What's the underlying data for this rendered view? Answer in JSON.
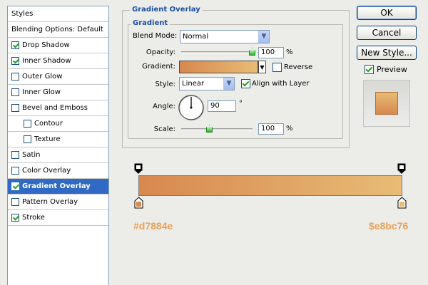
{
  "sidebar": {
    "header": "Styles",
    "items": [
      {
        "label": "Blending Options: Default",
        "checkbox": false,
        "checked": false,
        "indent": false,
        "selected": false
      },
      {
        "label": "Drop Shadow",
        "checkbox": true,
        "checked": true,
        "indent": false,
        "selected": false
      },
      {
        "label": "Inner Shadow",
        "checkbox": true,
        "checked": true,
        "indent": false,
        "selected": false
      },
      {
        "label": "Outer Glow",
        "checkbox": true,
        "checked": false,
        "indent": false,
        "selected": false
      },
      {
        "label": "Inner Glow",
        "checkbox": true,
        "checked": false,
        "indent": false,
        "selected": false
      },
      {
        "label": "Bevel and Emboss",
        "checkbox": true,
        "checked": false,
        "indent": false,
        "selected": false
      },
      {
        "label": "Contour",
        "checkbox": true,
        "checked": false,
        "indent": true,
        "selected": false
      },
      {
        "label": "Texture",
        "checkbox": true,
        "checked": false,
        "indent": true,
        "selected": false
      },
      {
        "label": "Satin",
        "checkbox": true,
        "checked": false,
        "indent": false,
        "selected": false
      },
      {
        "label": "Color Overlay",
        "checkbox": true,
        "checked": false,
        "indent": false,
        "selected": false
      },
      {
        "label": "Gradient Overlay",
        "checkbox": true,
        "checked": true,
        "indent": false,
        "selected": true
      },
      {
        "label": "Pattern Overlay",
        "checkbox": true,
        "checked": false,
        "indent": false,
        "selected": false
      },
      {
        "label": "Stroke",
        "checkbox": true,
        "checked": true,
        "indent": false,
        "selected": false
      }
    ]
  },
  "gradient_overlay": {
    "title": "Gradient Overlay",
    "section": "Gradient",
    "blend_mode_label": "Blend Mode:",
    "blend_mode_value": "Normal",
    "opacity_label": "Opacity:",
    "opacity_value": "100",
    "opacity_level": 1.0,
    "percent": "%",
    "gradient_label": "Gradient:",
    "reverse_label": "Reverse",
    "reverse_checked": false,
    "style_label": "Style:",
    "style_value": "Linear",
    "align_label": "Align with Layer",
    "align_checked": true,
    "angle_label": "Angle:",
    "angle_value": "90",
    "degree": "°",
    "scale_label": "Scale:",
    "scale_value": "100",
    "scale_level": 0.4
  },
  "buttons": {
    "ok": "OK",
    "cancel": "Cancel",
    "new_style": "New Style...",
    "preview_label": "Preview",
    "preview_checked": true
  },
  "gradient_editor": {
    "start_color": "#d7884e",
    "end_color": "#e8bc76",
    "start_label": "#d7884e",
    "end_label": "$e8bc76"
  },
  "colors": {
    "accent": "#316ac5",
    "legend": "#1b4fa8",
    "annotation": "#e8a15a"
  }
}
